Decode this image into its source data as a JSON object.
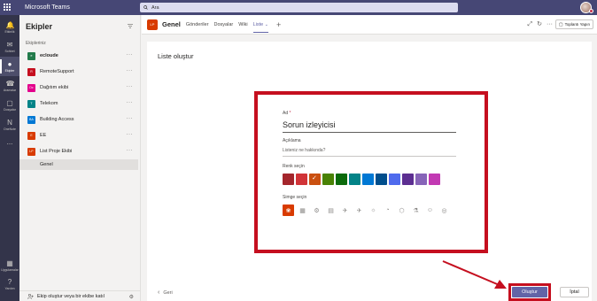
{
  "app": {
    "title": "Microsoft Teams",
    "search_placeholder": "Ara"
  },
  "rail": {
    "items": [
      {
        "label": "Etkinlik",
        "icon": "bell-icon"
      },
      {
        "label": "Sohbet",
        "icon": "chat-icon"
      },
      {
        "label": "Ekipler",
        "icon": "teams-icon",
        "active": true
      },
      {
        "label": "Aramalar",
        "icon": "phone-icon"
      },
      {
        "label": "Dosyalar",
        "icon": "file-icon"
      },
      {
        "label": "OneNote",
        "icon": "onenote-icon"
      },
      {
        "label": "...",
        "icon": "more-icon"
      },
      {
        "label": "Uygulamalar",
        "icon": "apps-icon"
      },
      {
        "label": "Yardım",
        "icon": "help-icon"
      }
    ]
  },
  "teams_panel": {
    "title": "Ekipler",
    "section_label": "Ekipleriniz",
    "teams": [
      {
        "name": "ecloude",
        "color": "#237b4b",
        "bold": true
      },
      {
        "name": "RemoteSupport",
        "color": "#c50f1f"
      },
      {
        "name": "Dağıtım ekibi",
        "color": "#e3008c"
      },
      {
        "name": "Telekom",
        "color": "#038387"
      },
      {
        "name": "Building Access",
        "color": "#0078d4"
      },
      {
        "name": "EE",
        "color": "#d83b01"
      },
      {
        "name": "List Proje Ekibi",
        "color": "#d83b01"
      }
    ],
    "active_channel": "Genel",
    "join_label": "Ekip oluştur veya bir ekibe katıl"
  },
  "channel_header": {
    "channel_name": "Genel",
    "tabs": [
      "Gönderiler",
      "Dosyalar",
      "Wiki",
      "Liste"
    ],
    "active_tab": "Liste",
    "meet_label": "Toplantı Yapın"
  },
  "form": {
    "page_title": "Liste oluştur",
    "name_label": "Ad",
    "name_value": "Sorun izleyicisi",
    "desc_label": "Açıklama",
    "desc_placeholder": "Listeniz ne hakkında?",
    "color_label": "Renk seçin",
    "colors": [
      "#a4262c",
      "#d13438",
      "#ca5010",
      "#498205",
      "#0b6a0b",
      "#038387",
      "#0078d4",
      "#004e8c",
      "#4f6bed",
      "#5c2e91",
      "#8764b8",
      "#c239b3"
    ],
    "selected_color_index": 2,
    "icon_label": "Simge seçin",
    "icons": [
      "bug-icon",
      "calendar-icon",
      "gear-icon",
      "clipboard-icon",
      "rocket-icon",
      "airplane-icon",
      "lightbulb-icon",
      "palette-icon",
      "cube-icon",
      "flask-icon",
      "people-icon",
      "piggybank-icon"
    ],
    "selected_icon_index": 0,
    "back_label": "Geri",
    "create_label": "Oluştur",
    "cancel_label": "İptal"
  }
}
